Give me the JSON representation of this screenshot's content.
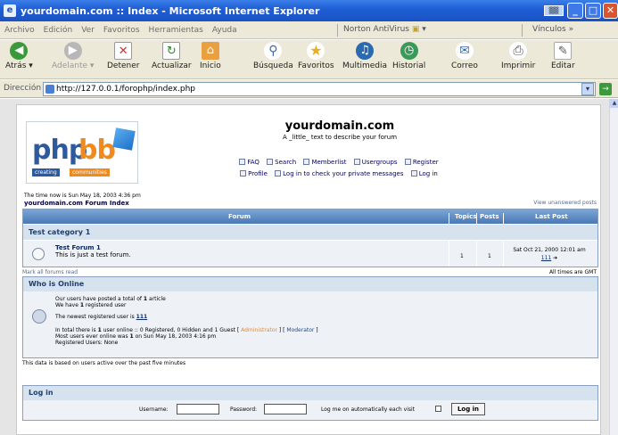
{
  "window": {
    "title": "yourdomain.com :: Index - Microsoft Internet Explorer"
  },
  "menubar": {
    "items": [
      "Archivo",
      "Edición",
      "Ver",
      "Favoritos",
      "Herramientas",
      "Ayuda"
    ],
    "norton": "Norton AntiVirus",
    "vinculos": "Vínculos"
  },
  "toolbar": {
    "back": "Atrás",
    "forward": "Adelante",
    "stop": "Detener",
    "refresh": "Actualizar",
    "home": "Inicio",
    "search": "Búsqueda",
    "favorites": "Favoritos",
    "media": "Multimedia",
    "history": "Historial",
    "mail": "Correo",
    "print": "Imprimir",
    "edit": "Editar"
  },
  "address": {
    "label": "Dirección",
    "url": "http://127.0.0.1/forophp/index.php",
    "go": "Ir"
  },
  "site": {
    "name": "yourdomain.com",
    "description": "A _little_ text to describe your forum",
    "links_row1": [
      "FAQ",
      "Search",
      "Memberlist",
      "Usergroups",
      "Register"
    ],
    "links_row2": [
      "Profile",
      "Log in to check your private messages",
      "Log in"
    ]
  },
  "status": {
    "time_now": "The time now is Sun May 18, 2003 4:36 pm",
    "forum_index": "yourdomain.com Forum Index",
    "unanswered": "View unanswered posts"
  },
  "forum_table": {
    "headers": {
      "forum": "Forum",
      "topics": "Topics",
      "posts": "Posts",
      "last_post": "Last Post"
    },
    "category": "Test category 1",
    "forum": {
      "name": "Test Forum 1",
      "description": "This is just a test forum.",
      "topics": "1",
      "posts": "1",
      "last_post_date": "Sat Oct 21, 2000 12:01 am",
      "last_post_user": "111"
    },
    "mark_read": "Mark all forums read",
    "timezone": "All times are GMT"
  },
  "online": {
    "title": "Who is Online",
    "line1_pre": "Our users have posted a total of ",
    "line1_num": "1",
    "line1_post": " article",
    "line2_pre": "We have ",
    "line2_num": "1",
    "line2_post": " registered user",
    "line3_pre": "The newest registered user is ",
    "line3_user": "111",
    "line4_pre": "In total there is ",
    "line4_num": "1",
    "line4_post": " user online :: 0 Registered, 0 Hidden and 1 Guest  [ ",
    "legend_admin": "Administrator",
    "legend_sep": " ]  [ ",
    "legend_mod": "Moderator",
    "legend_end": " ]",
    "line5_pre": "Most users ever online was ",
    "line5_num": "1",
    "line5_post": " on Sun May 18, 2003 4:16 pm",
    "line6": "Registered Users: None",
    "based_on": "This data is based on users active over the past five minutes"
  },
  "login": {
    "title": "Log in",
    "username_label": "Username:",
    "password_label": "Password:",
    "auto_label": "Log me on automatically each visit",
    "button": "Log in"
  }
}
